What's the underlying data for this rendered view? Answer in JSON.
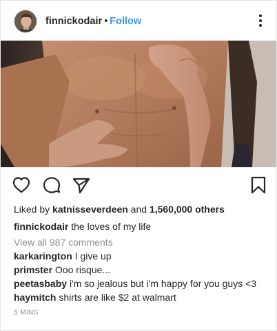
{
  "header": {
    "username": "finnickodair",
    "separator": "•",
    "follow_label": "Follow",
    "more_icon": "more-vertical-icon"
  },
  "actions": {
    "like_icon": "heart-icon",
    "comment_icon": "comment-icon",
    "share_icon": "paper-plane-icon",
    "save_icon": "bookmark-icon"
  },
  "likes": {
    "prefix": "Liked by ",
    "user": "katnisseverdeen",
    "conjunction": " and ",
    "others": "1,560,000 others"
  },
  "caption": {
    "username": "finnickodair",
    "text": "the loves of my life"
  },
  "view_comments": "View all 987 comments",
  "comments": [
    {
      "username": "karkarington",
      "text": "I give up"
    },
    {
      "username": "primster",
      "text": "Ooo risque..."
    },
    {
      "username": "peetasbaby",
      "text": "i'm so jealous but i'm happy for you guys <3"
    },
    {
      "username": "haymitch",
      "text": "shirts are like $2 at walmart"
    }
  ],
  "timestamp": "5 MINS",
  "colors": {
    "link": "#3897f0",
    "text": "#262626",
    "muted": "#8e8e8e",
    "border": "#e6e6e6"
  }
}
